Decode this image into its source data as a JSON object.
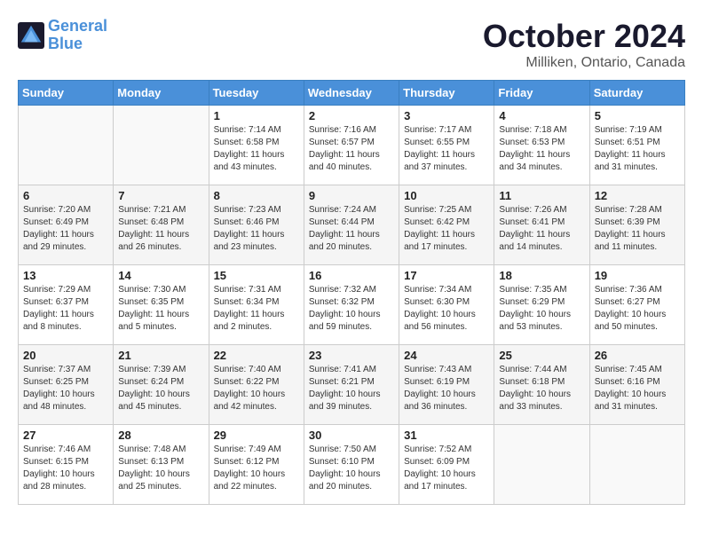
{
  "header": {
    "logo_line1": "General",
    "logo_line2": "Blue",
    "title": "October 2024",
    "subtitle": "Milliken, Ontario, Canada"
  },
  "days_of_week": [
    "Sunday",
    "Monday",
    "Tuesday",
    "Wednesday",
    "Thursday",
    "Friday",
    "Saturday"
  ],
  "weeks": [
    [
      {
        "day": "",
        "info": ""
      },
      {
        "day": "",
        "info": ""
      },
      {
        "day": "1",
        "info": "Sunrise: 7:14 AM\nSunset: 6:58 PM\nDaylight: 11 hours and 43 minutes."
      },
      {
        "day": "2",
        "info": "Sunrise: 7:16 AM\nSunset: 6:57 PM\nDaylight: 11 hours and 40 minutes."
      },
      {
        "day": "3",
        "info": "Sunrise: 7:17 AM\nSunset: 6:55 PM\nDaylight: 11 hours and 37 minutes."
      },
      {
        "day": "4",
        "info": "Sunrise: 7:18 AM\nSunset: 6:53 PM\nDaylight: 11 hours and 34 minutes."
      },
      {
        "day": "5",
        "info": "Sunrise: 7:19 AM\nSunset: 6:51 PM\nDaylight: 11 hours and 31 minutes."
      }
    ],
    [
      {
        "day": "6",
        "info": "Sunrise: 7:20 AM\nSunset: 6:49 PM\nDaylight: 11 hours and 29 minutes."
      },
      {
        "day": "7",
        "info": "Sunrise: 7:21 AM\nSunset: 6:48 PM\nDaylight: 11 hours and 26 minutes."
      },
      {
        "day": "8",
        "info": "Sunrise: 7:23 AM\nSunset: 6:46 PM\nDaylight: 11 hours and 23 minutes."
      },
      {
        "day": "9",
        "info": "Sunrise: 7:24 AM\nSunset: 6:44 PM\nDaylight: 11 hours and 20 minutes."
      },
      {
        "day": "10",
        "info": "Sunrise: 7:25 AM\nSunset: 6:42 PM\nDaylight: 11 hours and 17 minutes."
      },
      {
        "day": "11",
        "info": "Sunrise: 7:26 AM\nSunset: 6:41 PM\nDaylight: 11 hours and 14 minutes."
      },
      {
        "day": "12",
        "info": "Sunrise: 7:28 AM\nSunset: 6:39 PM\nDaylight: 11 hours and 11 minutes."
      }
    ],
    [
      {
        "day": "13",
        "info": "Sunrise: 7:29 AM\nSunset: 6:37 PM\nDaylight: 11 hours and 8 minutes."
      },
      {
        "day": "14",
        "info": "Sunrise: 7:30 AM\nSunset: 6:35 PM\nDaylight: 11 hours and 5 minutes."
      },
      {
        "day": "15",
        "info": "Sunrise: 7:31 AM\nSunset: 6:34 PM\nDaylight: 11 hours and 2 minutes."
      },
      {
        "day": "16",
        "info": "Sunrise: 7:32 AM\nSunset: 6:32 PM\nDaylight: 10 hours and 59 minutes."
      },
      {
        "day": "17",
        "info": "Sunrise: 7:34 AM\nSunset: 6:30 PM\nDaylight: 10 hours and 56 minutes."
      },
      {
        "day": "18",
        "info": "Sunrise: 7:35 AM\nSunset: 6:29 PM\nDaylight: 10 hours and 53 minutes."
      },
      {
        "day": "19",
        "info": "Sunrise: 7:36 AM\nSunset: 6:27 PM\nDaylight: 10 hours and 50 minutes."
      }
    ],
    [
      {
        "day": "20",
        "info": "Sunrise: 7:37 AM\nSunset: 6:25 PM\nDaylight: 10 hours and 48 minutes."
      },
      {
        "day": "21",
        "info": "Sunrise: 7:39 AM\nSunset: 6:24 PM\nDaylight: 10 hours and 45 minutes."
      },
      {
        "day": "22",
        "info": "Sunrise: 7:40 AM\nSunset: 6:22 PM\nDaylight: 10 hours and 42 minutes."
      },
      {
        "day": "23",
        "info": "Sunrise: 7:41 AM\nSunset: 6:21 PM\nDaylight: 10 hours and 39 minutes."
      },
      {
        "day": "24",
        "info": "Sunrise: 7:43 AM\nSunset: 6:19 PM\nDaylight: 10 hours and 36 minutes."
      },
      {
        "day": "25",
        "info": "Sunrise: 7:44 AM\nSunset: 6:18 PM\nDaylight: 10 hours and 33 minutes."
      },
      {
        "day": "26",
        "info": "Sunrise: 7:45 AM\nSunset: 6:16 PM\nDaylight: 10 hours and 31 minutes."
      }
    ],
    [
      {
        "day": "27",
        "info": "Sunrise: 7:46 AM\nSunset: 6:15 PM\nDaylight: 10 hours and 28 minutes."
      },
      {
        "day": "28",
        "info": "Sunrise: 7:48 AM\nSunset: 6:13 PM\nDaylight: 10 hours and 25 minutes."
      },
      {
        "day": "29",
        "info": "Sunrise: 7:49 AM\nSunset: 6:12 PM\nDaylight: 10 hours and 22 minutes."
      },
      {
        "day": "30",
        "info": "Sunrise: 7:50 AM\nSunset: 6:10 PM\nDaylight: 10 hours and 20 minutes."
      },
      {
        "day": "31",
        "info": "Sunrise: 7:52 AM\nSunset: 6:09 PM\nDaylight: 10 hours and 17 minutes."
      },
      {
        "day": "",
        "info": ""
      },
      {
        "day": "",
        "info": ""
      }
    ]
  ]
}
